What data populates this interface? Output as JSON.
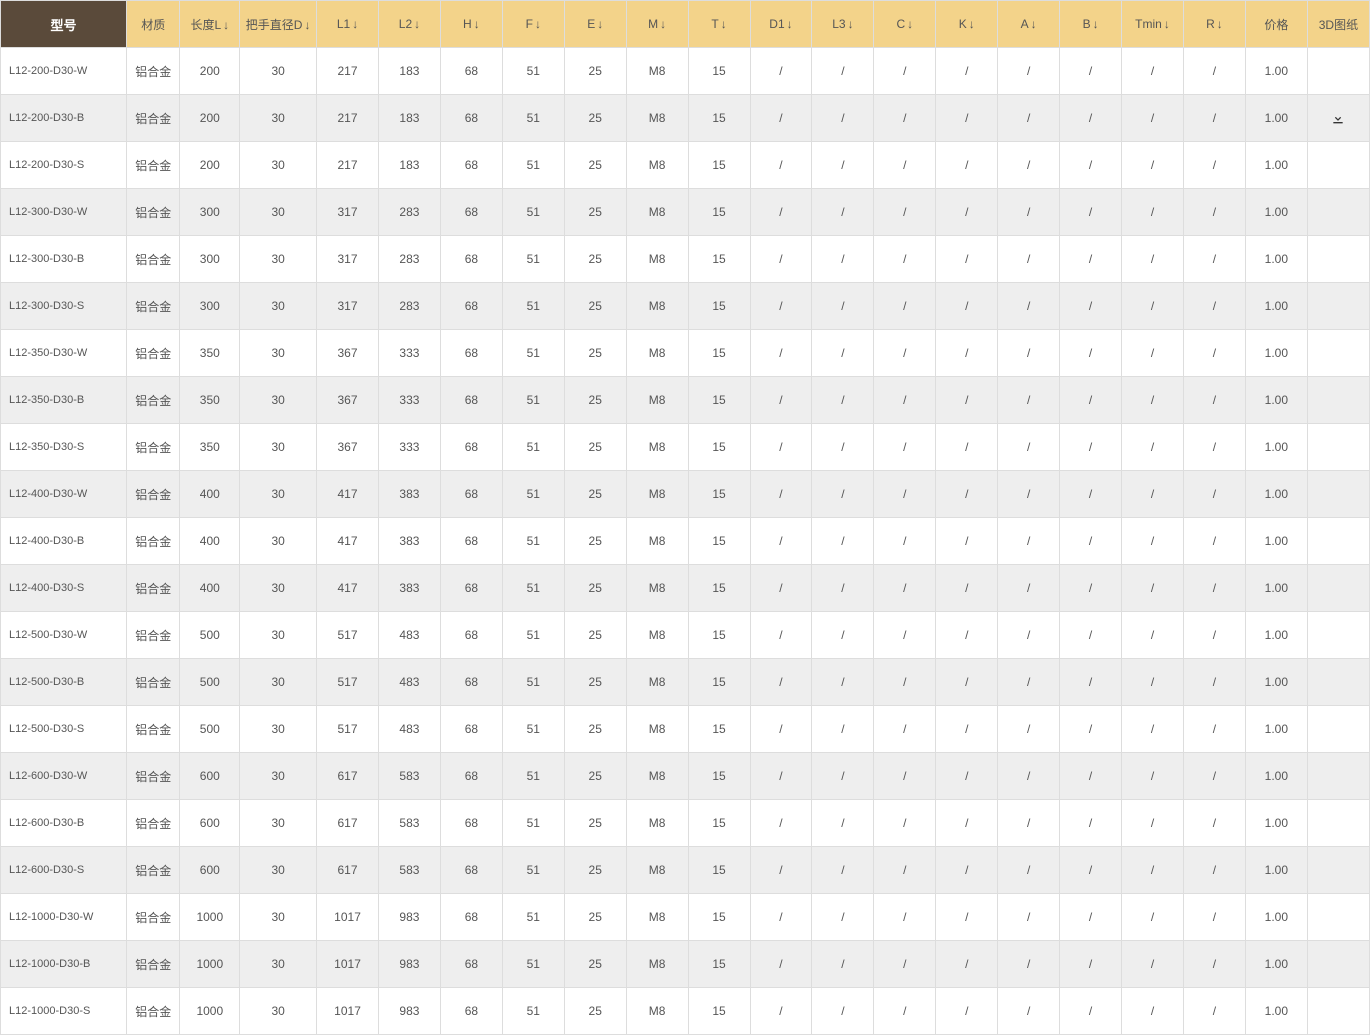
{
  "headers": {
    "model": "型号",
    "material": "材质",
    "length": "长度L",
    "diameter": "把手直径D",
    "L1": "L1",
    "L2": "L2",
    "H": "H",
    "F": "F",
    "E": "E",
    "M": "M",
    "T": "T",
    "D1": "D1",
    "L3": "L3",
    "C": "C",
    "K": "K",
    "A": "A",
    "B": "B",
    "Tmin": "Tmin",
    "R": "R",
    "price": "价格",
    "drawing3d": "3D图纸"
  },
  "sort_indicator": "↓",
  "rows": [
    {
      "model": "L12-200-D30-W",
      "material": "铝合金",
      "length": "200",
      "diameter": "30",
      "L1": "217",
      "L2": "183",
      "H": "68",
      "F": "51",
      "E": "25",
      "M": "M8",
      "T": "15",
      "D1": "/",
      "L3": "/",
      "C": "/",
      "K": "/",
      "A": "/",
      "B": "/",
      "Tmin": "/",
      "R": "/",
      "price": "1.00",
      "download": false
    },
    {
      "model": "L12-200-D30-B",
      "material": "铝合金",
      "length": "200",
      "diameter": "30",
      "L1": "217",
      "L2": "183",
      "H": "68",
      "F": "51",
      "E": "25",
      "M": "M8",
      "T": "15",
      "D1": "/",
      "L3": "/",
      "C": "/",
      "K": "/",
      "A": "/",
      "B": "/",
      "Tmin": "/",
      "R": "/",
      "price": "1.00",
      "download": true
    },
    {
      "model": "L12-200-D30-S",
      "material": "铝合金",
      "length": "200",
      "diameter": "30",
      "L1": "217",
      "L2": "183",
      "H": "68",
      "F": "51",
      "E": "25",
      "M": "M8",
      "T": "15",
      "D1": "/",
      "L3": "/",
      "C": "/",
      "K": "/",
      "A": "/",
      "B": "/",
      "Tmin": "/",
      "R": "/",
      "price": "1.00",
      "download": false
    },
    {
      "model": "L12-300-D30-W",
      "material": "铝合金",
      "length": "300",
      "diameter": "30",
      "L1": "317",
      "L2": "283",
      "H": "68",
      "F": "51",
      "E": "25",
      "M": "M8",
      "T": "15",
      "D1": "/",
      "L3": "/",
      "C": "/",
      "K": "/",
      "A": "/",
      "B": "/",
      "Tmin": "/",
      "R": "/",
      "price": "1.00",
      "download": false
    },
    {
      "model": "L12-300-D30-B",
      "material": "铝合金",
      "length": "300",
      "diameter": "30",
      "L1": "317",
      "L2": "283",
      "H": "68",
      "F": "51",
      "E": "25",
      "M": "M8",
      "T": "15",
      "D1": "/",
      "L3": "/",
      "C": "/",
      "K": "/",
      "A": "/",
      "B": "/",
      "Tmin": "/",
      "R": "/",
      "price": "1.00",
      "download": false
    },
    {
      "model": "L12-300-D30-S",
      "material": "铝合金",
      "length": "300",
      "diameter": "30",
      "L1": "317",
      "L2": "283",
      "H": "68",
      "F": "51",
      "E": "25",
      "M": "M8",
      "T": "15",
      "D1": "/",
      "L3": "/",
      "C": "/",
      "K": "/",
      "A": "/",
      "B": "/",
      "Tmin": "/",
      "R": "/",
      "price": "1.00",
      "download": false
    },
    {
      "model": "L12-350-D30-W",
      "material": "铝合金",
      "length": "350",
      "diameter": "30",
      "L1": "367",
      "L2": "333",
      "H": "68",
      "F": "51",
      "E": "25",
      "M": "M8",
      "T": "15",
      "D1": "/",
      "L3": "/",
      "C": "/",
      "K": "/",
      "A": "/",
      "B": "/",
      "Tmin": "/",
      "R": "/",
      "price": "1.00",
      "download": false
    },
    {
      "model": "L12-350-D30-B",
      "material": "铝合金",
      "length": "350",
      "diameter": "30",
      "L1": "367",
      "L2": "333",
      "H": "68",
      "F": "51",
      "E": "25",
      "M": "M8",
      "T": "15",
      "D1": "/",
      "L3": "/",
      "C": "/",
      "K": "/",
      "A": "/",
      "B": "/",
      "Tmin": "/",
      "R": "/",
      "price": "1.00",
      "download": false
    },
    {
      "model": "L12-350-D30-S",
      "material": "铝合金",
      "length": "350",
      "diameter": "30",
      "L1": "367",
      "L2": "333",
      "H": "68",
      "F": "51",
      "E": "25",
      "M": "M8",
      "T": "15",
      "D1": "/",
      "L3": "/",
      "C": "/",
      "K": "/",
      "A": "/",
      "B": "/",
      "Tmin": "/",
      "R": "/",
      "price": "1.00",
      "download": false
    },
    {
      "model": "L12-400-D30-W",
      "material": "铝合金",
      "length": "400",
      "diameter": "30",
      "L1": "417",
      "L2": "383",
      "H": "68",
      "F": "51",
      "E": "25",
      "M": "M8",
      "T": "15",
      "D1": "/",
      "L3": "/",
      "C": "/",
      "K": "/",
      "A": "/",
      "B": "/",
      "Tmin": "/",
      "R": "/",
      "price": "1.00",
      "download": false
    },
    {
      "model": "L12-400-D30-B",
      "material": "铝合金",
      "length": "400",
      "diameter": "30",
      "L1": "417",
      "L2": "383",
      "H": "68",
      "F": "51",
      "E": "25",
      "M": "M8",
      "T": "15",
      "D1": "/",
      "L3": "/",
      "C": "/",
      "K": "/",
      "A": "/",
      "B": "/",
      "Tmin": "/",
      "R": "/",
      "price": "1.00",
      "download": false
    },
    {
      "model": "L12-400-D30-S",
      "material": "铝合金",
      "length": "400",
      "diameter": "30",
      "L1": "417",
      "L2": "383",
      "H": "68",
      "F": "51",
      "E": "25",
      "M": "M8",
      "T": "15",
      "D1": "/",
      "L3": "/",
      "C": "/",
      "K": "/",
      "A": "/",
      "B": "/",
      "Tmin": "/",
      "R": "/",
      "price": "1.00",
      "download": false
    },
    {
      "model": "L12-500-D30-W",
      "material": "铝合金",
      "length": "500",
      "diameter": "30",
      "L1": "517",
      "L2": "483",
      "H": "68",
      "F": "51",
      "E": "25",
      "M": "M8",
      "T": "15",
      "D1": "/",
      "L3": "/",
      "C": "/",
      "K": "/",
      "A": "/",
      "B": "/",
      "Tmin": "/",
      "R": "/",
      "price": "1.00",
      "download": false
    },
    {
      "model": "L12-500-D30-B",
      "material": "铝合金",
      "length": "500",
      "diameter": "30",
      "L1": "517",
      "L2": "483",
      "H": "68",
      "F": "51",
      "E": "25",
      "M": "M8",
      "T": "15",
      "D1": "/",
      "L3": "/",
      "C": "/",
      "K": "/",
      "A": "/",
      "B": "/",
      "Tmin": "/",
      "R": "/",
      "price": "1.00",
      "download": false
    },
    {
      "model": "L12-500-D30-S",
      "material": "铝合金",
      "length": "500",
      "diameter": "30",
      "L1": "517",
      "L2": "483",
      "H": "68",
      "F": "51",
      "E": "25",
      "M": "M8",
      "T": "15",
      "D1": "/",
      "L3": "/",
      "C": "/",
      "K": "/",
      "A": "/",
      "B": "/",
      "Tmin": "/",
      "R": "/",
      "price": "1.00",
      "download": false
    },
    {
      "model": "L12-600-D30-W",
      "material": "铝合金",
      "length": "600",
      "diameter": "30",
      "L1": "617",
      "L2": "583",
      "H": "68",
      "F": "51",
      "E": "25",
      "M": "M8",
      "T": "15",
      "D1": "/",
      "L3": "/",
      "C": "/",
      "K": "/",
      "A": "/",
      "B": "/",
      "Tmin": "/",
      "R": "/",
      "price": "1.00",
      "download": false
    },
    {
      "model": "L12-600-D30-B",
      "material": "铝合金",
      "length": "600",
      "diameter": "30",
      "L1": "617",
      "L2": "583",
      "H": "68",
      "F": "51",
      "E": "25",
      "M": "M8",
      "T": "15",
      "D1": "/",
      "L3": "/",
      "C": "/",
      "K": "/",
      "A": "/",
      "B": "/",
      "Tmin": "/",
      "R": "/",
      "price": "1.00",
      "download": false
    },
    {
      "model": "L12-600-D30-S",
      "material": "铝合金",
      "length": "600",
      "diameter": "30",
      "L1": "617",
      "L2": "583",
      "H": "68",
      "F": "51",
      "E": "25",
      "M": "M8",
      "T": "15",
      "D1": "/",
      "L3": "/",
      "C": "/",
      "K": "/",
      "A": "/",
      "B": "/",
      "Tmin": "/",
      "R": "/",
      "price": "1.00",
      "download": false
    },
    {
      "model": "L12-1000-D30-W",
      "material": "铝合金",
      "length": "1000",
      "diameter": "30",
      "L1": "1017",
      "L2": "983",
      "H": "68",
      "F": "51",
      "E": "25",
      "M": "M8",
      "T": "15",
      "D1": "/",
      "L3": "/",
      "C": "/",
      "K": "/",
      "A": "/",
      "B": "/",
      "Tmin": "/",
      "R": "/",
      "price": "1.00",
      "download": false
    },
    {
      "model": "L12-1000-D30-B",
      "material": "铝合金",
      "length": "1000",
      "diameter": "30",
      "L1": "1017",
      "L2": "983",
      "H": "68",
      "F": "51",
      "E": "25",
      "M": "M8",
      "T": "15",
      "D1": "/",
      "L3": "/",
      "C": "/",
      "K": "/",
      "A": "/",
      "B": "/",
      "Tmin": "/",
      "R": "/",
      "price": "1.00",
      "download": false
    },
    {
      "model": "L12-1000-D30-S",
      "material": "铝合金",
      "length": "1000",
      "diameter": "30",
      "L1": "1017",
      "L2": "983",
      "H": "68",
      "F": "51",
      "E": "25",
      "M": "M8",
      "T": "15",
      "D1": "/",
      "L3": "/",
      "C": "/",
      "K": "/",
      "A": "/",
      "B": "/",
      "Tmin": "/",
      "R": "/",
      "price": "1.00",
      "download": false
    }
  ]
}
